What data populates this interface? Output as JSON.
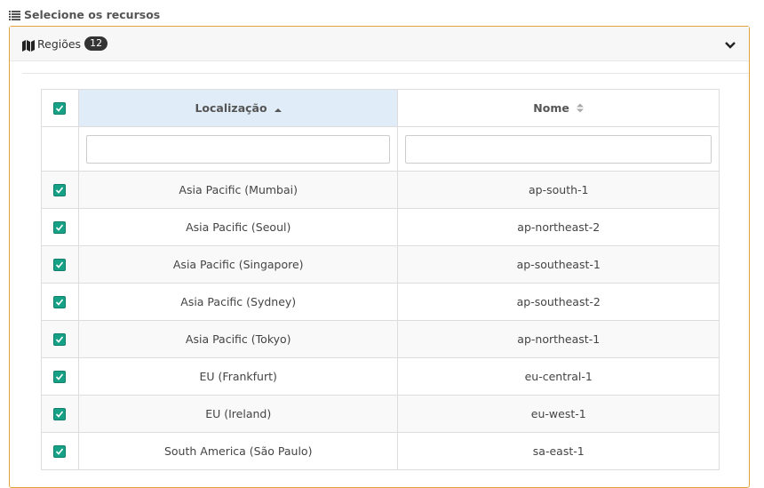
{
  "section": {
    "title": "Selecione os recursos",
    "icon": "list-icon"
  },
  "panel": {
    "title": "Regiões",
    "badge": "12",
    "icon": "map-icon",
    "collapse_icon": "chevron-down-icon",
    "accent_color": "#e2a33a"
  },
  "table": {
    "columns": [
      {
        "label": "Localização",
        "sort": "asc"
      },
      {
        "label": "Nome",
        "sort": "none"
      }
    ],
    "filters": [
      {
        "value": "",
        "placeholder": ""
      },
      {
        "value": "",
        "placeholder": ""
      }
    ],
    "rows": [
      {
        "location": "Asia Pacific (Mumbai)",
        "name": "ap-south-1",
        "checked": true
      },
      {
        "location": "Asia Pacific (Seoul)",
        "name": "ap-northeast-2",
        "checked": true
      },
      {
        "location": "Asia Pacific (Singapore)",
        "name": "ap-southeast-1",
        "checked": true
      },
      {
        "location": "Asia Pacific (Sydney)",
        "name": "ap-southeast-2",
        "checked": true
      },
      {
        "location": "Asia Pacific (Tokyo)",
        "name": "ap-northeast-1",
        "checked": true
      },
      {
        "location": "EU (Frankfurt)",
        "name": "eu-central-1",
        "checked": true
      },
      {
        "location": "EU (Ireland)",
        "name": "eu-west-1",
        "checked": true
      },
      {
        "location": "South America (São Paulo)",
        "name": "sa-east-1",
        "checked": true
      }
    ],
    "checkbox_color": "#16a085"
  }
}
